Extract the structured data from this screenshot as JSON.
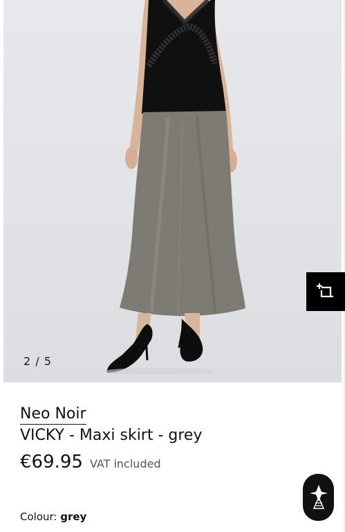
{
  "gallery": {
    "counter": "2 / 5",
    "crop_icon": "crop-add-icon"
  },
  "product": {
    "brand": "Neo Noir",
    "title": "VICKY - Maxi skirt - grey",
    "price": "€69.95",
    "vat_label": "VAT included",
    "colour_label": "Colour:",
    "colour_value": "grey"
  },
  "floating_button": {
    "icon": "brand-logo-icon"
  },
  "colors": {
    "background": "#ffffff",
    "photo_background": "#e4e5e9",
    "skirt": "#7d7b72",
    "top": "#0f0f10",
    "button": "#000000"
  }
}
